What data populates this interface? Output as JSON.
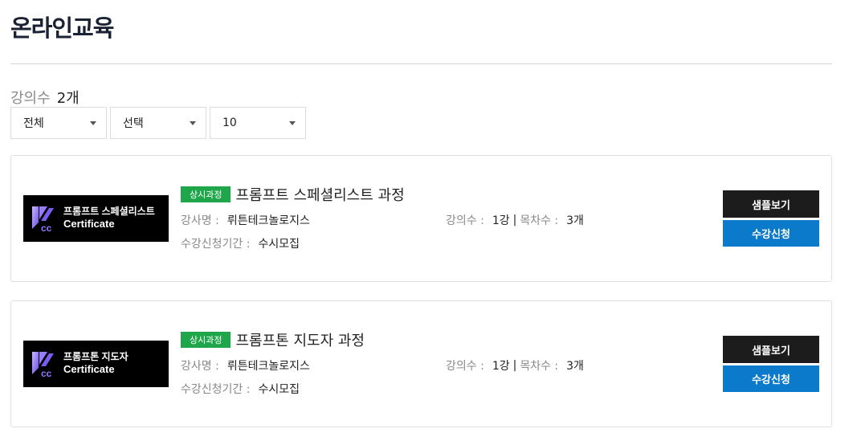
{
  "page": {
    "title": "온라인교육"
  },
  "summary": {
    "count_label": "강의수",
    "count_value": "2개"
  },
  "filters": [
    {
      "value": "전체"
    },
    {
      "value": "선택"
    },
    {
      "value": "10"
    }
  ],
  "labels": {
    "badge": "상시과정",
    "instructor": "강사명 :",
    "lectures": "강의수 :",
    "chapters": "목차수 :",
    "period": "수강신청기간 :",
    "separator": "|",
    "sample_button": "샘플보기",
    "apply_button": "수강신청"
  },
  "courses": [
    {
      "thumb_ko": "프롬프트 스페셜리스트",
      "thumb_en": "Certificate",
      "title": "프롬프트 스페셜리스트 과정",
      "instructor": "뤼튼테크놀로지스",
      "lectures": "1강",
      "chapters": "3개",
      "period": "수시모집"
    },
    {
      "thumb_ko": "프롬프톤 지도자",
      "thumb_en": "Certificate",
      "title": "프롬프톤 지도자 과정",
      "instructor": "뤼튼테크놀로지스",
      "lectures": "1강",
      "chapters": "3개",
      "period": "수시모집"
    }
  ],
  "colors": {
    "badge": "#1fa64a",
    "apply_button": "#0c7acb",
    "sample_button": "#1c1c1c"
  }
}
